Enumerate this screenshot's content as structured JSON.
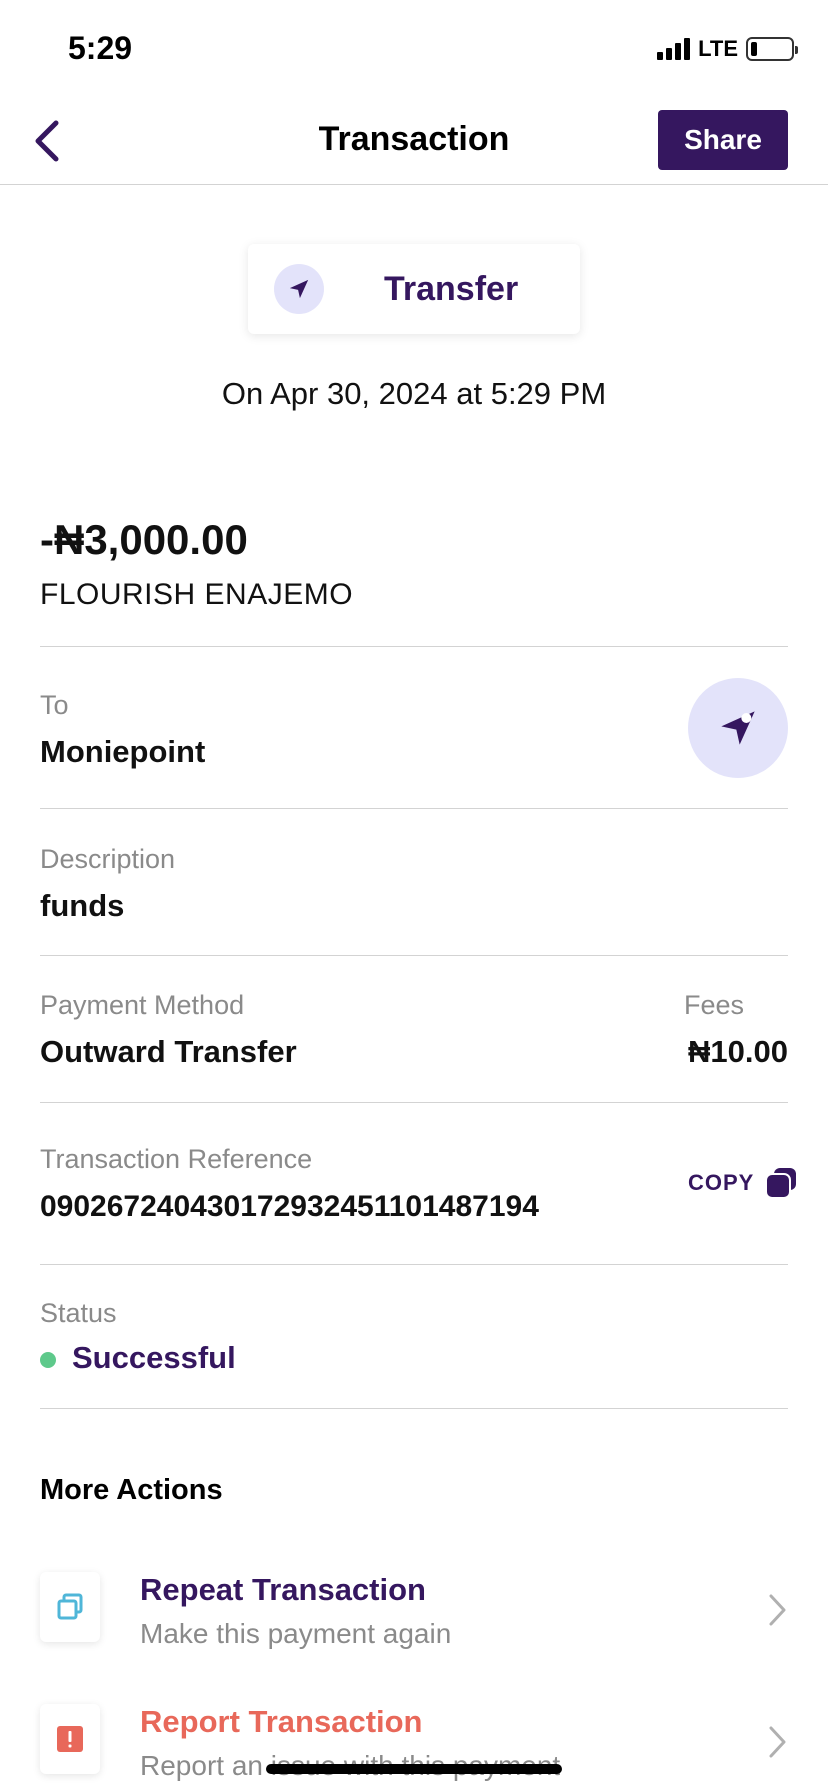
{
  "status_bar": {
    "time": "5:29",
    "network": "LTE",
    "battery_level": 0.15
  },
  "header": {
    "title": "Transaction",
    "back_icon": "chevron-left-icon",
    "share_label": "Share"
  },
  "transaction": {
    "type_icon": "send-icon",
    "type_label": "Transfer",
    "date_line": "On Apr 30, 2024 at 5:29 PM",
    "amount": "-₦3,000.00",
    "counterparty": "FLOURISH ENAJEMO",
    "to_label": "To",
    "to_value": "Moniepoint",
    "description_label": "Description",
    "description_value": "funds",
    "payment_method_label": "Payment Method",
    "payment_method_value": "Outward Transfer",
    "fees_label": "Fees",
    "fees_value": "₦10.00",
    "reference_label": "Transaction Reference",
    "reference_value": "090267240430172932451101487194",
    "copy_label": "COPY",
    "status_label": "Status",
    "status_value": "Successful"
  },
  "more_actions": {
    "title": "More Actions",
    "items": [
      {
        "title": "Repeat Transaction",
        "subtitle": "Make this payment again",
        "icon": "repeat-icon"
      },
      {
        "title": "Report Transaction",
        "subtitle": "Report an issue with this payment",
        "icon": "alert-icon"
      }
    ]
  },
  "colors": {
    "brand": "#35175f",
    "accent_light": "#e3e3fa",
    "success": "#5ec98b",
    "danger": "#e8685a",
    "repeat_icon": "#4fb6d8"
  }
}
